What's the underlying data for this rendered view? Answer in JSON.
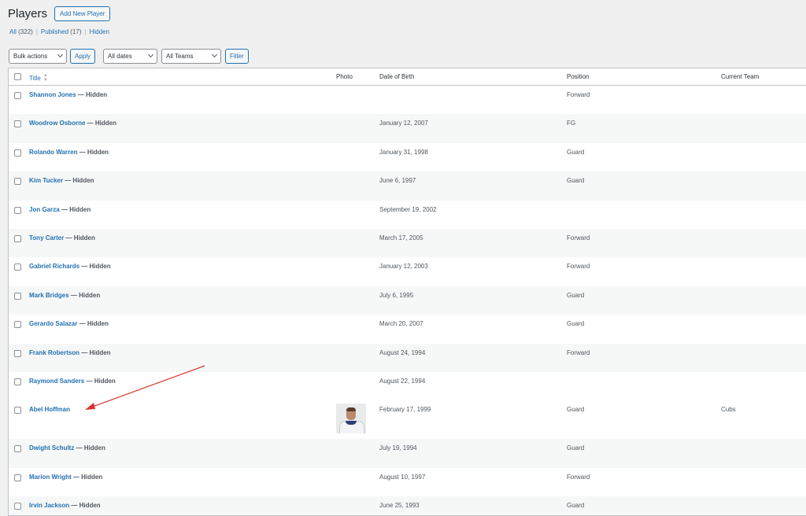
{
  "header": {
    "title": "Players",
    "add_new_label": "Add New Player"
  },
  "views": [
    {
      "label": "All",
      "count": "(322)"
    },
    {
      "label": "Published",
      "count": "(17)"
    },
    {
      "label": "Hidden",
      "count": ""
    }
  ],
  "separator": "|",
  "toolbar": {
    "bulk_actions": "Bulk actions",
    "apply": "Apply",
    "dates": "All dates",
    "teams": "All Teams",
    "filter": "Filter"
  },
  "columns": {
    "title": "Title",
    "photo": "Photo",
    "dob": "Date of Birth",
    "position": "Position",
    "team": "Current Team"
  },
  "rows": [
    {
      "name": "Shannon Jones",
      "state": " — Hidden",
      "dob": "",
      "position": "Forward",
      "team": ""
    },
    {
      "name": "Woodrow Osborne",
      "state": " — Hidden",
      "dob": "January 12, 2007",
      "position": "FG",
      "team": ""
    },
    {
      "name": "Rolando Warren",
      "state": " — Hidden",
      "dob": "January 31, 1998",
      "position": "Guard",
      "team": ""
    },
    {
      "name": "Kim Tucker",
      "state": " — Hidden",
      "dob": "June 6, 1997",
      "position": "Guard",
      "team": ""
    },
    {
      "name": "Jon Garza",
      "state": " — Hidden",
      "dob": "September 19, 2002",
      "position": "",
      "team": ""
    },
    {
      "name": "Tony Carter",
      "state": " — Hidden",
      "dob": "March 17, 2005",
      "position": "Forward",
      "team": ""
    },
    {
      "name": "Gabriel Richards",
      "state": " — Hidden",
      "dob": "January 12, 2003",
      "position": "Forward",
      "team": ""
    },
    {
      "name": "Mark Bridges",
      "state": " — Hidden",
      "dob": "July 6, 1995",
      "position": "Guard",
      "team": ""
    },
    {
      "name": "Gerardo Salazar",
      "state": " — Hidden",
      "dob": "March 20, 2007",
      "position": "Guard",
      "team": ""
    },
    {
      "name": "Frank Robertson",
      "state": " — Hidden",
      "dob": "August 24, 1994",
      "position": "Forward",
      "team": ""
    },
    {
      "name": "Raymond Sanders",
      "state": " — Hidden",
      "dob": "August 22, 1994",
      "position": "",
      "team": ""
    },
    {
      "name": "Abel Hoffman",
      "state": "",
      "dob": "February 17, 1999",
      "position": "Guard",
      "team": "Cubs",
      "has_photo": true
    },
    {
      "name": "Dwight Schultz",
      "state": " — Hidden",
      "dob": "July 19, 1994",
      "position": "Guard",
      "team": ""
    },
    {
      "name": "Marion Wright",
      "state": " — Hidden",
      "dob": "August 10, 1997",
      "position": "Forward",
      "team": ""
    },
    {
      "name": "Irvin Jackson",
      "state": " — Hidden",
      "dob": "June 25, 1993",
      "position": "Guard",
      "team": ""
    }
  ],
  "colors": {
    "link": "#2271b1",
    "arrow": "#d9342b",
    "row_alt": "#f6f7f7"
  }
}
